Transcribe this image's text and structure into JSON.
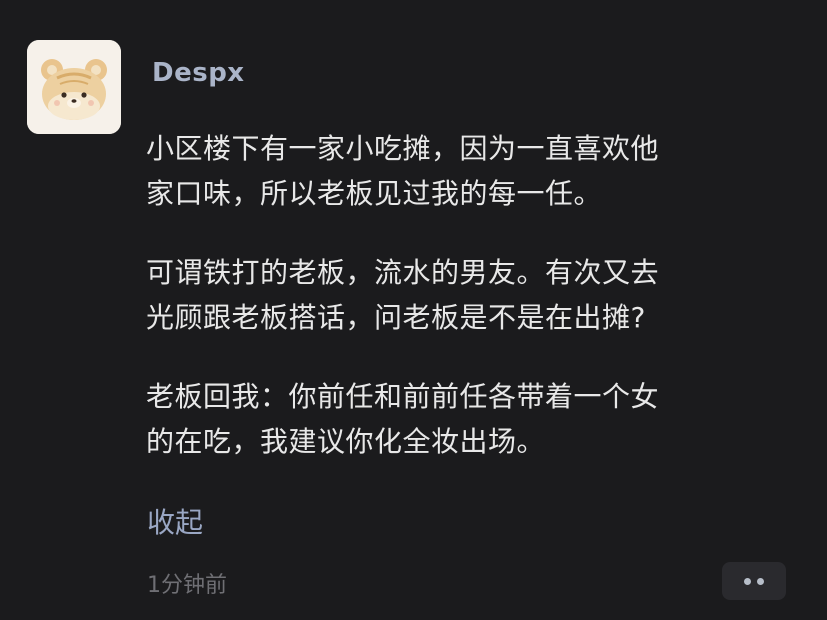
{
  "post": {
    "author": "Despx",
    "paragraphs": [
      [
        "小区楼下有一家小吃摊，因为一直喜欢他",
        "家口味，所以老板见过我的每一任。"
      ],
      [
        "可谓铁打的老板，流水的男友。有次又去",
        "光顾跟老板搭话，问老板是不是在出摊?"
      ],
      [
        "老板回我：你前任和前前任各带着一个女",
        "的在吃，我建议你化全妆出场。"
      ]
    ],
    "collapse_label": "收起",
    "timestamp": "1分钟前"
  },
  "icons": {
    "avatar": "bear-avatar-icon",
    "more": "more-dots-icon"
  },
  "colors": {
    "background": "#1b1b1d",
    "username": "#aab4c8",
    "link": "#9aa7c4",
    "timestamp": "#6f6f74"
  }
}
